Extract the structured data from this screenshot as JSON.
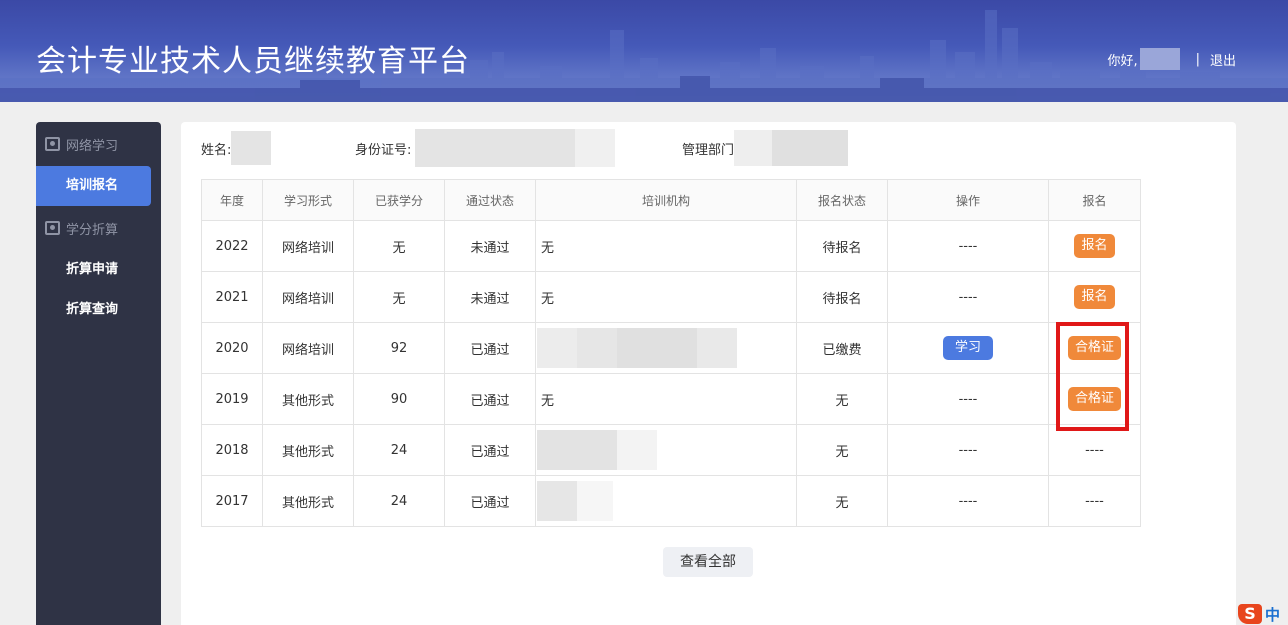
{
  "header": {
    "title": "会计专业技术人员继续教育平台",
    "greeting": "你好,",
    "separator": "|",
    "logout_label": "退出"
  },
  "sidebar": {
    "groups": [
      {
        "label": "网络学习",
        "icon": "monitor-icon"
      },
      {
        "label": "学分折算",
        "icon": "calculator-icon"
      }
    ],
    "items": {
      "training_signup": "培训报名",
      "conversion_apply": "折算申请",
      "conversion_query": "折算查询"
    },
    "active_item": "培训报名"
  },
  "profile": {
    "name_label": "姓名:",
    "id_label": "身份证号:",
    "dept_label": "管理部门"
  },
  "table": {
    "headers": [
      "年度",
      "学习形式",
      "已获学分",
      "通过状态",
      "培训机构",
      "报名状态",
      "操作",
      "报名"
    ],
    "rows": [
      {
        "year": "2022",
        "form": "网络培训",
        "credits": "无",
        "pass": "未通过",
        "org": "无",
        "signup_status": "待报名",
        "action": "----",
        "signup": "报名"
      },
      {
        "year": "2021",
        "form": "网络培训",
        "credits": "无",
        "pass": "未通过",
        "org": "无",
        "signup_status": "待报名",
        "action": "----",
        "signup": "报名"
      },
      {
        "year": "2020",
        "form": "网络培训",
        "credits": "92",
        "pass": "已通过",
        "org": "",
        "signup_status": "已缴费",
        "action": "学习",
        "signup": "合格证"
      },
      {
        "year": "2019",
        "form": "其他形式",
        "credits": "90",
        "pass": "已通过",
        "org": "无",
        "signup_status": "无",
        "action": "----",
        "signup": "合格证"
      },
      {
        "year": "2018",
        "form": "其他形式",
        "credits": "24",
        "pass": "已通过",
        "org": "",
        "signup_status": "无",
        "action": "----",
        "signup": "----"
      },
      {
        "year": "2017",
        "form": "其他形式",
        "credits": "24",
        "pass": "已通过",
        "org": "",
        "signup_status": "无",
        "action": "----",
        "signup": "----"
      }
    ]
  },
  "view_all_label": "查看全部",
  "ime": {
    "logo": "S",
    "label": "中"
  },
  "colors": {
    "accent_blue": "#4c7ae0",
    "accent_orange": "#f0893a",
    "pending_text": "#ef8a35",
    "highlight_red": "#e01818",
    "sidebar_bg": "#2f3345"
  }
}
